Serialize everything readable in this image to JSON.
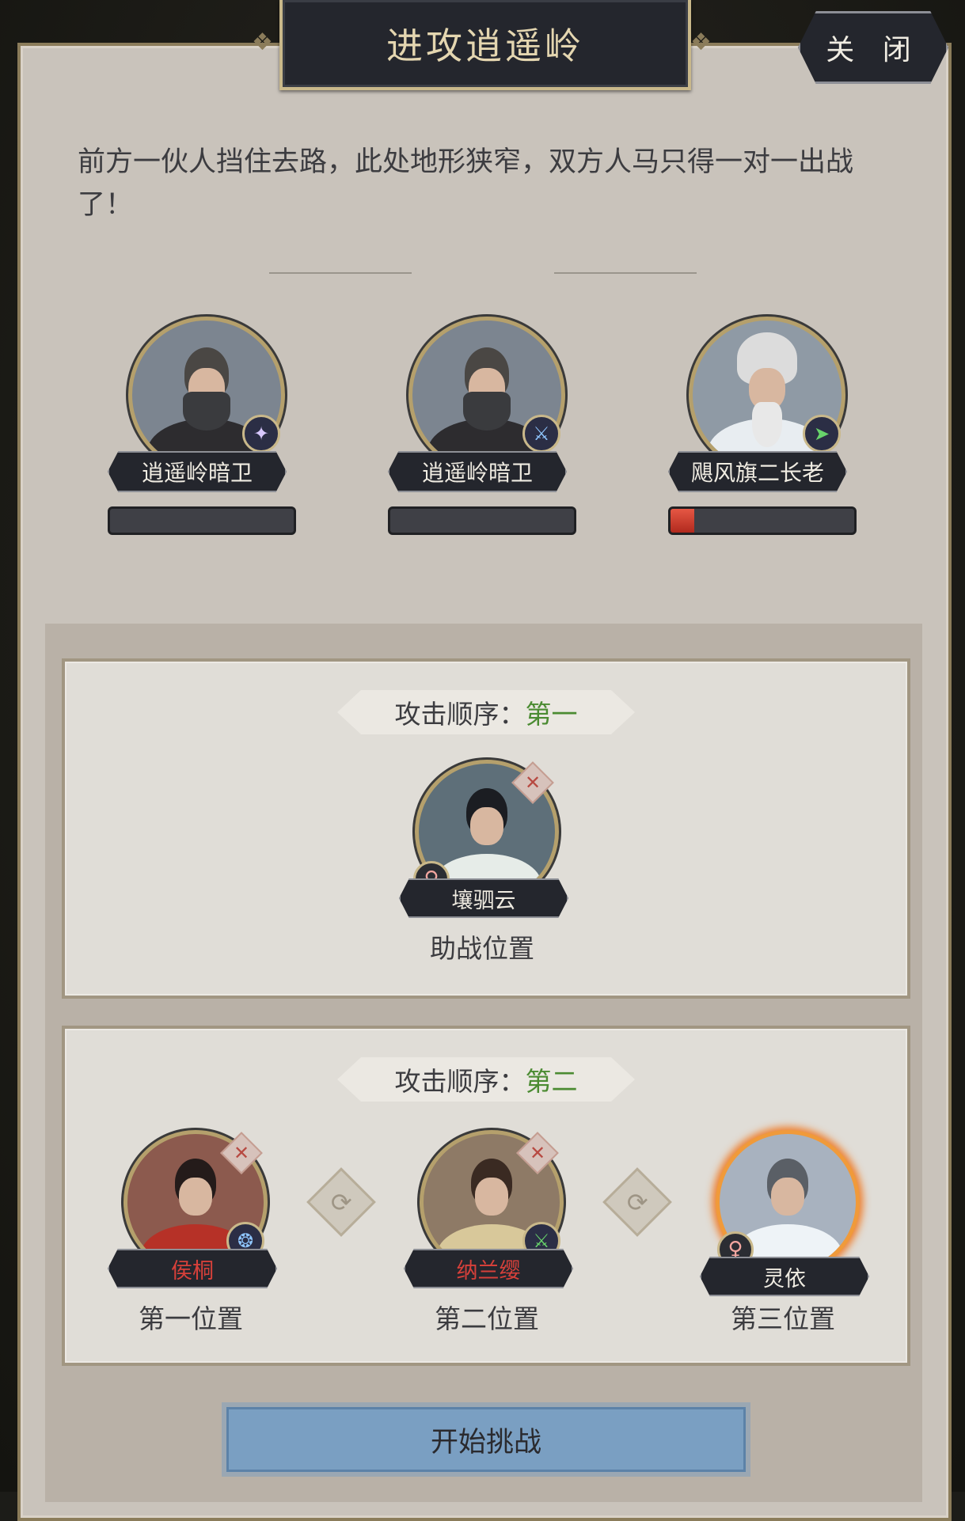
{
  "title": "进攻逍遥岭",
  "close_label": "关 闭",
  "intro_text": "前方一伙人挡住去路，此处地形狭窄，双方人马只得一对一出战了！",
  "enemies": [
    {
      "name": "逍遥岭暗卫",
      "hp_fraction": 0.0,
      "class_icon": "spear-icon"
    },
    {
      "name": "逍遥岭暗卫",
      "hp_fraction": 0.0,
      "class_icon": "blade-icon"
    },
    {
      "name": "飓风旗二长老",
      "hp_fraction": 0.13,
      "class_icon": "boot-icon"
    }
  ],
  "team1": {
    "order_label": "攻击顺序：",
    "order_value": "第一",
    "member": {
      "name": "壤驷云",
      "position_label": "助战位置",
      "gender": "♀"
    }
  },
  "team2": {
    "order_label": "攻击顺序：",
    "order_value": "第二",
    "members": [
      {
        "name": "侯桐",
        "position_label": "第一位置",
        "name_color": "#d6403a"
      },
      {
        "name": "纳兰缨",
        "position_label": "第二位置",
        "name_color": "#d6403a"
      },
      {
        "name": "灵依",
        "position_label": "第三位置",
        "gender": "♀"
      }
    ]
  },
  "start_button": "开始挑战",
  "colors": {
    "accent_green": "#4b8b32",
    "hp_red": "#d6403a",
    "button_blue": "#7a9fc2"
  }
}
